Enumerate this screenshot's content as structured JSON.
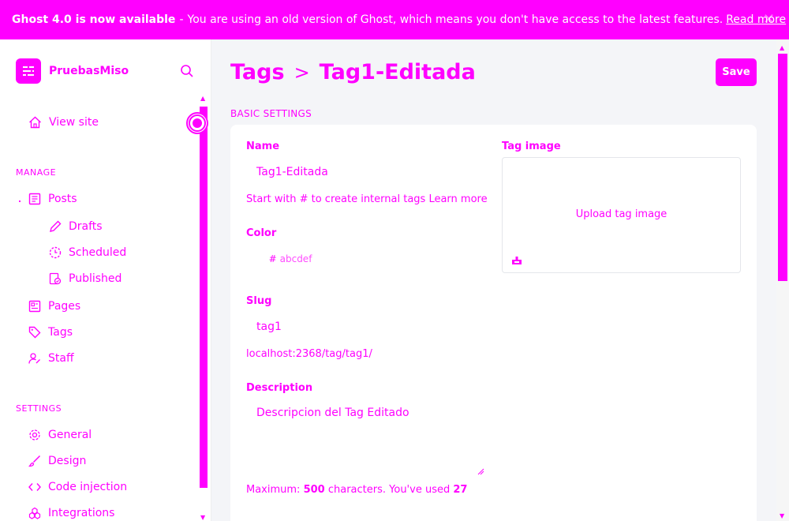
{
  "banner": {
    "bold": "Ghost 4.0 is now available",
    "separator": "-",
    "message": "You are using an old version of Ghost, which means you don't have access to the latest features.",
    "link": "Read more",
    "close_icon": "close-icon"
  },
  "brand": {
    "name": "PruebasMiso",
    "logo_icon": "ghost-logo-icon"
  },
  "sidebar": {
    "view_site": "View site",
    "manage_label": "MANAGE",
    "settings_label": "SETTINGS",
    "manage_items": [
      {
        "label": "Posts",
        "icon": "posts-icon"
      },
      {
        "label": "Drafts",
        "icon": "pencil-icon"
      },
      {
        "label": "Scheduled",
        "icon": "clock-icon"
      },
      {
        "label": "Published",
        "icon": "published-icon"
      },
      {
        "label": "Pages",
        "icon": "pages-icon"
      },
      {
        "label": "Tags",
        "icon": "tag-icon"
      },
      {
        "label": "Staff",
        "icon": "staff-icon"
      }
    ],
    "settings_items": [
      {
        "label": "General",
        "icon": "gear-icon"
      },
      {
        "label": "Design",
        "icon": "brush-icon"
      },
      {
        "label": "Code injection",
        "icon": "code-icon"
      },
      {
        "label": "Integrations",
        "icon": "integrations-icon"
      }
    ]
  },
  "header": {
    "crumb_parent": "Tags",
    "crumb_separator": ">",
    "crumb_current": "Tag1-Editada",
    "save_label": "Save"
  },
  "form": {
    "section_title": "BASIC SETTINGS",
    "name_label": "Name",
    "name_value": "Tag1-Editada",
    "name_help": "Start with # to create internal tags Learn more",
    "color_label": "Color",
    "color_prefix": "#",
    "color_placeholder": "abcdef",
    "slug_label": "Slug",
    "slug_value": "tag1",
    "slug_url": "localhost:2368/tag/tag1/",
    "description_label": "Description",
    "description_value": "Descripcion del Tag Editado",
    "desc_help_pre": "Maximum:",
    "desc_help_max": "500",
    "desc_help_mid": "characters. You've used",
    "desc_help_used": "27",
    "tag_image_label": "Tag image",
    "upload_label": "Upload tag image"
  },
  "colors": {
    "accent": "#ff00ff",
    "background": "#f4f5f8",
    "card": "#ffffff"
  }
}
